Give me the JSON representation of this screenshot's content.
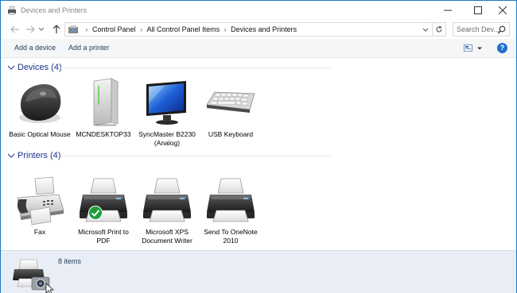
{
  "window": {
    "title": "Devices and Printers",
    "accent": "#1979ca"
  },
  "address": {
    "crumbs": [
      "Control Panel",
      "All Control Panel Items",
      "Devices and Printers"
    ],
    "search_placeholder": "Search Dev..."
  },
  "toolbar": {
    "add_device": "Add a device",
    "add_printer": "Add a printer",
    "help": "?"
  },
  "groups": {
    "devices": {
      "label": "Devices (4)",
      "items": [
        {
          "label": "Basic Optical Mouse",
          "icon": "mouse-icon"
        },
        {
          "label": "MCNDESKTOP33",
          "icon": "computer-icon"
        },
        {
          "label": "SyncMaster B2230 (Analog)",
          "icon": "monitor-icon"
        },
        {
          "label": "USB Keyboard",
          "icon": "keyboard-icon"
        }
      ]
    },
    "printers": {
      "label": "Printers (4)",
      "items": [
        {
          "label": "Fax",
          "icon": "fax-icon"
        },
        {
          "label": "Microsoft Print to PDF",
          "icon": "printer-icon",
          "default": true
        },
        {
          "label": "Microsoft XPS Document Writer",
          "icon": "printer-icon"
        },
        {
          "label": "Send To OneNote 2010",
          "icon": "printer-icon"
        }
      ]
    }
  },
  "details": {
    "count_text": "8 items"
  },
  "colors": {
    "group_label": "#1e3287",
    "command_text": "#1e395b",
    "details_bg": "#e9edf5",
    "default_check": "#1e9c3a"
  }
}
